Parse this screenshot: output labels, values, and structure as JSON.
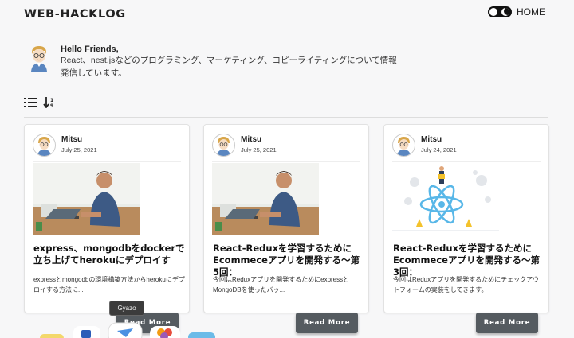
{
  "header": {
    "logo": "WEB-HACKLOG",
    "theme_toggle_icon": "moon-toggle-icon",
    "nav_home": "HOME"
  },
  "intro": {
    "greeting": "Hello Friends,",
    "bio": "React、nest.jsなどのプログラミング、マーケティング、コピーライティングについて情報発信しています。"
  },
  "toolbar": {
    "list_icon": "list-view-icon",
    "sort_icon": "sort-icon"
  },
  "posts": [
    {
      "author": "Mitsu",
      "date": "July 25, 2021",
      "title": "express、mongodbをdockerで立ち上げてherokuにデプロイす",
      "excerpt": "expressとmongodbの環境構築方法からherokuにデプロイする方法に...",
      "read_more": "Read More"
    },
    {
      "author": "Mitsu",
      "date": "July 25, 2021",
      "title": "React-Reduxを学習するためにEcommeceアプリを開発する〜第5回：",
      "excerpt": "今回はReduxアプリを開発するためにexpressとMongoDBを使ったバッ...",
      "read_more": "Read More"
    },
    {
      "author": "Mitsu",
      "date": "July 24, 2021",
      "title": "React-Reduxを学習するためにEcommeceアプリを開発する〜第3回：",
      "excerpt": "今回はReduxアプリを開発するためにチェックアウトフォームの実装をしてきます。",
      "read_more": "Read More"
    }
  ],
  "dock": {
    "tooltip": "Gyazo"
  }
}
